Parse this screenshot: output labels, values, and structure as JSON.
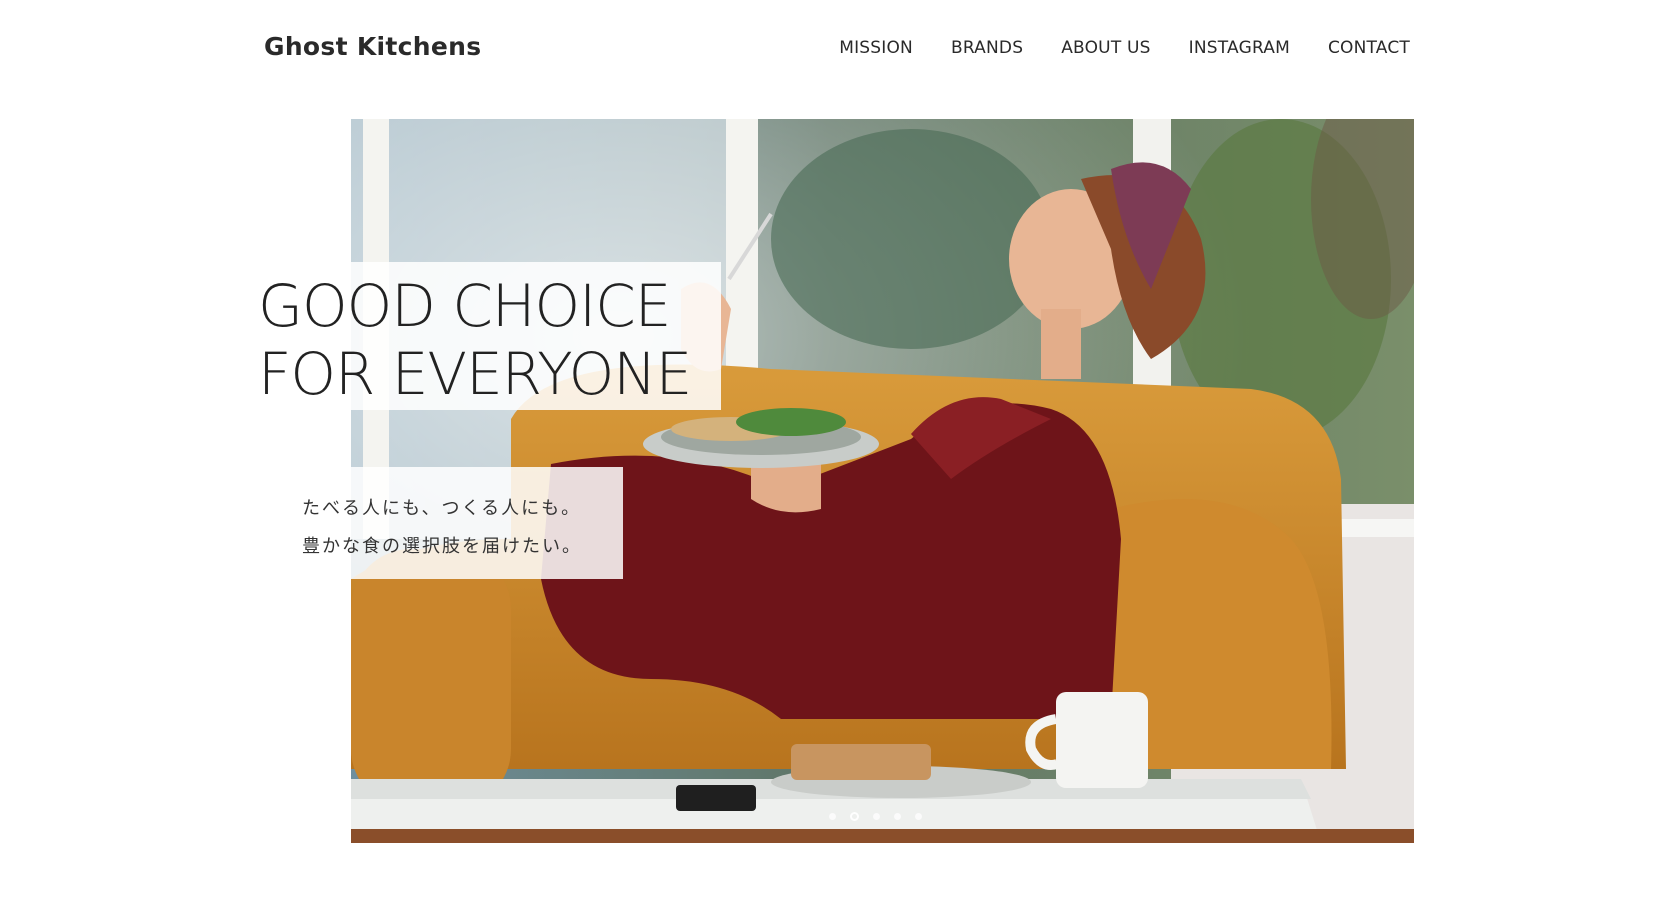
{
  "header": {
    "logo": "Ghost Kitchens",
    "nav": [
      {
        "label": "MISSION"
      },
      {
        "label": "BRANDS"
      },
      {
        "label": "ABOUT US"
      },
      {
        "label": "INSTAGRAM"
      },
      {
        "label": "CONTACT"
      }
    ]
  },
  "hero": {
    "headline_line1": "GOOD CHOICE",
    "headline_line2": "FOR EVERYONE",
    "sub_line1": "たべる人にも、つくる人にも。",
    "sub_line2": "豊かな食の選択肢を届けたい。",
    "slide_count": 5,
    "active_slide": 2
  }
}
